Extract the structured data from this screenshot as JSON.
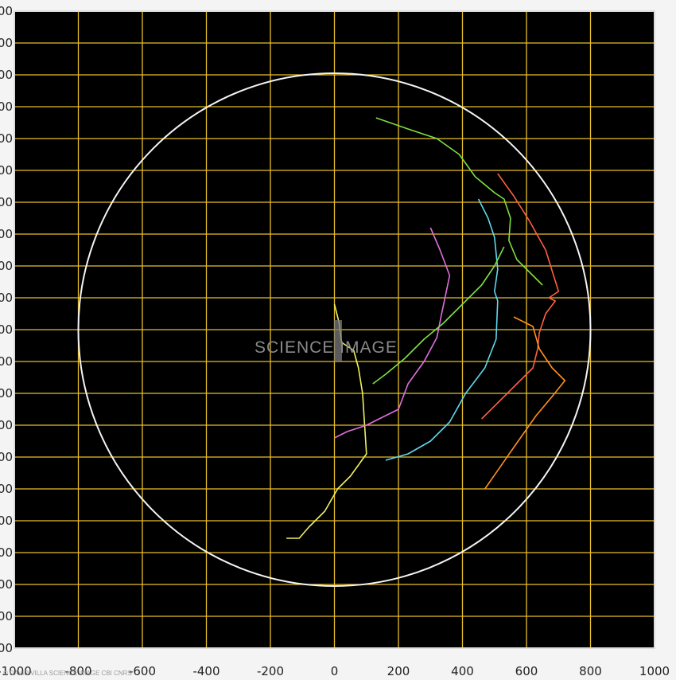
{
  "chart_data": {
    "type": "line",
    "xlim": [
      -1000,
      1000
    ],
    "ylim": [
      -1000,
      1000
    ],
    "grid": true,
    "x_ticks": [
      -1000,
      -800,
      -600,
      -400,
      -200,
      0,
      200,
      400,
      600,
      800,
      1000
    ],
    "x_tick_labels": [
      "-1000",
      "-800",
      "-600",
      "-400",
      "-200",
      "0",
      "200",
      "400",
      "600",
      "800",
      "1000"
    ],
    "y_tick_labels": [
      "00",
      "00",
      "00",
      "00",
      "00",
      "00",
      "00",
      "00",
      "00",
      "00",
      "00",
      "00",
      "00",
      "00",
      "00",
      "00",
      "00",
      "00",
      "00",
      "00",
      "00"
    ],
    "circle": {
      "center": [
        0,
        0
      ],
      "radius": 800
    },
    "series": [
      {
        "color": "#f0f060",
        "points": [
          [
            0,
            80
          ],
          [
            15,
            20
          ],
          [
            22,
            -40
          ],
          [
            60,
            -65
          ],
          [
            75,
            -120
          ],
          [
            88,
            -200
          ],
          [
            100,
            -390
          ],
          [
            50,
            -460
          ],
          [
            10,
            -500
          ],
          [
            -30,
            -570
          ],
          [
            -80,
            -620
          ],
          [
            -110,
            -655
          ],
          [
            -150,
            -655
          ]
        ]
      },
      {
        "color": "#e070e0",
        "points": [
          [
            300,
            320
          ],
          [
            330,
            250
          ],
          [
            360,
            170
          ],
          [
            335,
            50
          ],
          [
            320,
            -25
          ],
          [
            280,
            -100
          ],
          [
            230,
            -170
          ],
          [
            200,
            -250
          ],
          [
            140,
            -280
          ],
          [
            100,
            -300
          ],
          [
            40,
            -320
          ],
          [
            0,
            -340
          ]
        ]
      },
      {
        "color": "#60d8f0",
        "points": [
          [
            450,
            410
          ],
          [
            480,
            350
          ],
          [
            500,
            290
          ],
          [
            510,
            190
          ],
          [
            500,
            120
          ],
          [
            510,
            90
          ],
          [
            505,
            -30
          ],
          [
            470,
            -120
          ],
          [
            410,
            -200
          ],
          [
            360,
            -290
          ],
          [
            300,
            -350
          ],
          [
            230,
            -390
          ],
          [
            160,
            -410
          ]
        ]
      },
      {
        "color": "#80e040",
        "points": [
          [
            130,
            665
          ],
          [
            230,
            630
          ],
          [
            320,
            600
          ],
          [
            390,
            550
          ],
          [
            440,
            480
          ],
          [
            500,
            430
          ],
          [
            530,
            410
          ],
          [
            550,
            350
          ],
          [
            545,
            280
          ],
          [
            570,
            220
          ],
          [
            600,
            190
          ],
          [
            650,
            140
          ]
        ]
      },
      {
        "color": "#80e040",
        "points": [
          [
            530,
            260
          ],
          [
            500,
            200
          ],
          [
            460,
            140
          ],
          [
            400,
            80
          ],
          [
            340,
            20
          ],
          [
            280,
            -30
          ],
          [
            220,
            -90
          ],
          [
            160,
            -140
          ],
          [
            120,
            -170
          ]
        ]
      },
      {
        "color": "#ff6040",
        "points": [
          [
            510,
            490
          ],
          [
            560,
            420
          ],
          [
            610,
            340
          ],
          [
            660,
            250
          ],
          [
            700,
            120
          ],
          [
            670,
            100
          ],
          [
            690,
            90
          ],
          [
            660,
            50
          ],
          [
            640,
            -10
          ],
          [
            635,
            -60
          ],
          [
            620,
            -120
          ],
          [
            570,
            -170
          ],
          [
            510,
            -230
          ],
          [
            460,
            -280
          ]
        ]
      },
      {
        "color": "#ff9020",
        "points": [
          [
            560,
            40
          ],
          [
            620,
            10
          ],
          [
            640,
            -60
          ],
          [
            680,
            -120
          ],
          [
            720,
            -160
          ],
          [
            680,
            -210
          ],
          [
            630,
            -270
          ],
          [
            560,
            -370
          ],
          [
            470,
            -500
          ]
        ]
      }
    ]
  },
  "watermark": {
    "text": "SCIENCE IMAGE"
  },
  "credit": {
    "text": "© DAVID VILLA SCIENCE IMAGE CBI CNRS"
  },
  "colors": {
    "plot_bg": "#000000",
    "grid": "#e6c02a",
    "circle": "#f4f4f4",
    "frame": "#e0e0e0"
  }
}
